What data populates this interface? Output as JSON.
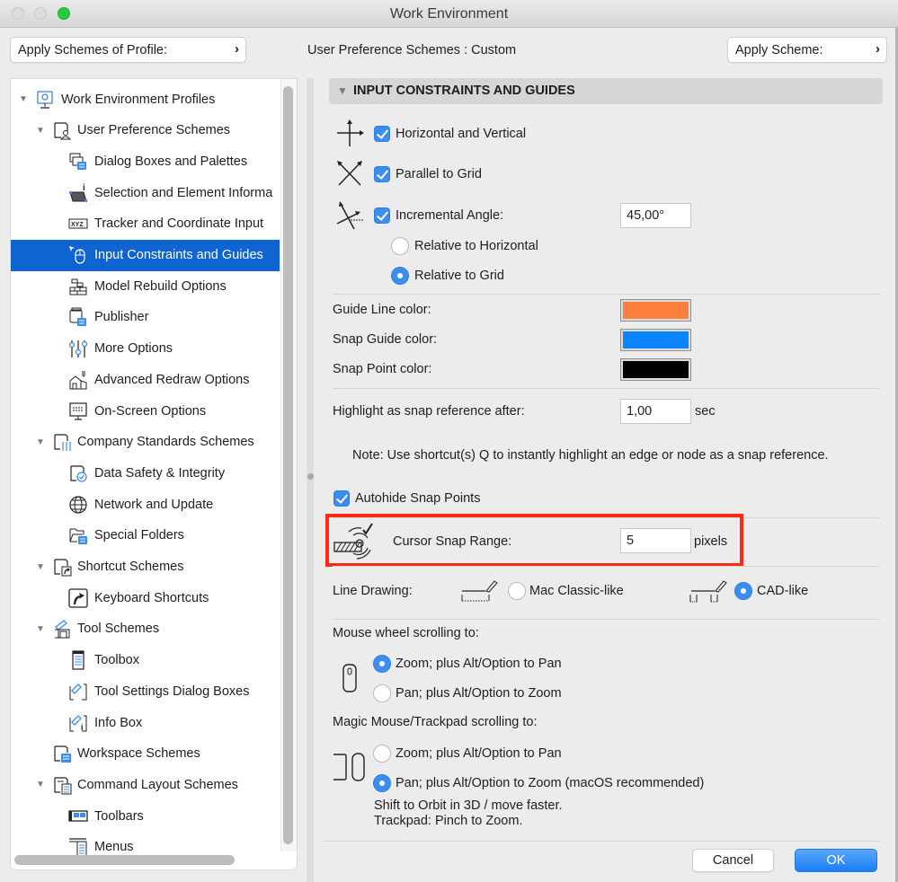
{
  "window": {
    "title": "Work Environment"
  },
  "header": {
    "apply_profile_button": "Apply Schemes of Profile:",
    "scheme_label": "User Preference Schemes",
    "scheme_separator": " : ",
    "scheme_value": "Custom",
    "apply_scheme_button": "Apply Scheme:",
    "chevron": "›"
  },
  "tree": {
    "items": [
      {
        "label": "Work Environment Profiles",
        "level": 0,
        "expanded": true,
        "icon": "profile-gear-monitor-icon"
      },
      {
        "label": "User Preference Schemes",
        "level": 1,
        "expanded": true,
        "icon": "user-scheme-icon"
      },
      {
        "label": "Dialog Boxes and Palettes",
        "level": 2,
        "icon": "dialog-palettes-icon"
      },
      {
        "label": "Selection and Element Informa",
        "level": 2,
        "icon": "selection-info-icon"
      },
      {
        "label": "Tracker and Coordinate Input",
        "level": 2,
        "icon": "xyz-tracker-icon"
      },
      {
        "label": "Input Constraints and Guides",
        "level": 2,
        "icon": "cursor-mouse-icon",
        "selected": true
      },
      {
        "label": "Model Rebuild Options",
        "level": 2,
        "icon": "brick-wall-icon"
      },
      {
        "label": "Publisher",
        "level": 2,
        "icon": "publisher-icon"
      },
      {
        "label": "More Options",
        "level": 2,
        "icon": "sliders-icon"
      },
      {
        "label": "Advanced Redraw Options",
        "level": 2,
        "icon": "house-redraw-icon"
      },
      {
        "label": "On-Screen Options",
        "level": 2,
        "icon": "monitor-icon"
      },
      {
        "label": "Company Standards Schemes",
        "level": 1,
        "expanded": true,
        "icon": "company-scheme-icon"
      },
      {
        "label": "Data Safety & Integrity",
        "level": 2,
        "icon": "data-safety-icon"
      },
      {
        "label": "Network and Update",
        "level": 2,
        "icon": "globe-icon"
      },
      {
        "label": "Special Folders",
        "level": 2,
        "icon": "folder-icon"
      },
      {
        "label": "Shortcut Schemes",
        "level": 1,
        "expanded": true,
        "icon": "shortcut-scheme-icon"
      },
      {
        "label": "Keyboard Shortcuts",
        "level": 2,
        "icon": "keyboard-shortcut-arrow-icon"
      },
      {
        "label": "Tool Schemes",
        "level": 1,
        "expanded": true,
        "icon": "tool-scheme-hammer-icon"
      },
      {
        "label": "Toolbox",
        "level": 2,
        "icon": "toolbox-icon"
      },
      {
        "label": "Tool Settings Dialog Boxes",
        "level": 2,
        "icon": "tool-settings-icon"
      },
      {
        "label": "Info Box",
        "level": 2,
        "icon": "info-box-icon"
      },
      {
        "label": "Workspace Schemes",
        "level": 1,
        "icon": "workspace-scheme-icon"
      },
      {
        "label": "Command Layout Schemes",
        "level": 1,
        "expanded": true,
        "icon": "command-layout-icon"
      },
      {
        "label": "Toolbars",
        "level": 2,
        "icon": "toolbars-icon"
      },
      {
        "label": "Menus",
        "level": 2,
        "icon": "menus-icon"
      }
    ]
  },
  "panel": {
    "section_title": "INPUT CONSTRAINTS AND GUIDES",
    "constraints": {
      "horizontal_vertical": {
        "label": "Horizontal and Vertical",
        "checked": true
      },
      "parallel_grid": {
        "label": "Parallel to Grid",
        "checked": true
      },
      "incremental_angle": {
        "label": "Incremental Angle:",
        "checked": true,
        "value": "45,00°"
      },
      "relative_horizontal": {
        "label": "Relative to Horizontal",
        "selected": false
      },
      "relative_grid": {
        "label": "Relative to Grid",
        "selected": true
      }
    },
    "colors": {
      "guide_line": {
        "label": "Guide Line color:",
        "value": "#ff7f3f"
      },
      "snap_guide": {
        "label": "Snap Guide color:",
        "value": "#0a84ff"
      },
      "snap_point": {
        "label": "Snap Point color:",
        "value": "#000000"
      }
    },
    "highlight": {
      "label": "Highlight as snap reference after:",
      "value": "1,00",
      "unit": "sec"
    },
    "note": "Note: Use shortcut(s) Q to instantly highlight an edge or node as a snap reference.",
    "autohide": {
      "label": "Autohide Snap Points",
      "checked": true
    },
    "cursor_snap": {
      "label": "Cursor Snap Range:",
      "value": "5",
      "unit": "pixels"
    },
    "line_drawing": {
      "label": "Line Drawing:",
      "mac_classic": {
        "label": "Mac Classic-like",
        "selected": false
      },
      "cad": {
        "label": "CAD-like",
        "selected": true
      }
    },
    "mouse_wheel": {
      "label": "Mouse wheel scrolling to:",
      "zoom_option": {
        "label": "Zoom; plus Alt/Option to Pan",
        "selected": true
      },
      "pan_option": {
        "label": "Pan; plus Alt/Option to Zoom",
        "selected": false
      }
    },
    "trackpad": {
      "label": "Magic Mouse/Trackpad scrolling to:",
      "zoom_option": {
        "label": "Zoom; plus Alt/Option to Pan",
        "selected": false
      },
      "pan_option": {
        "label": "Pan; plus Alt/Option to Zoom (macOS recommended)",
        "selected": true
      },
      "hint1": "Shift to Orbit in 3D / move faster.",
      "hint2": "Trackpad: Pinch to Zoom."
    }
  },
  "footer": {
    "cancel": "Cancel",
    "ok": "OK"
  },
  "accent": {
    "blue": "#3b8ef0",
    "selection": "#0f64d2",
    "highlight_box": "#ff2a12"
  }
}
